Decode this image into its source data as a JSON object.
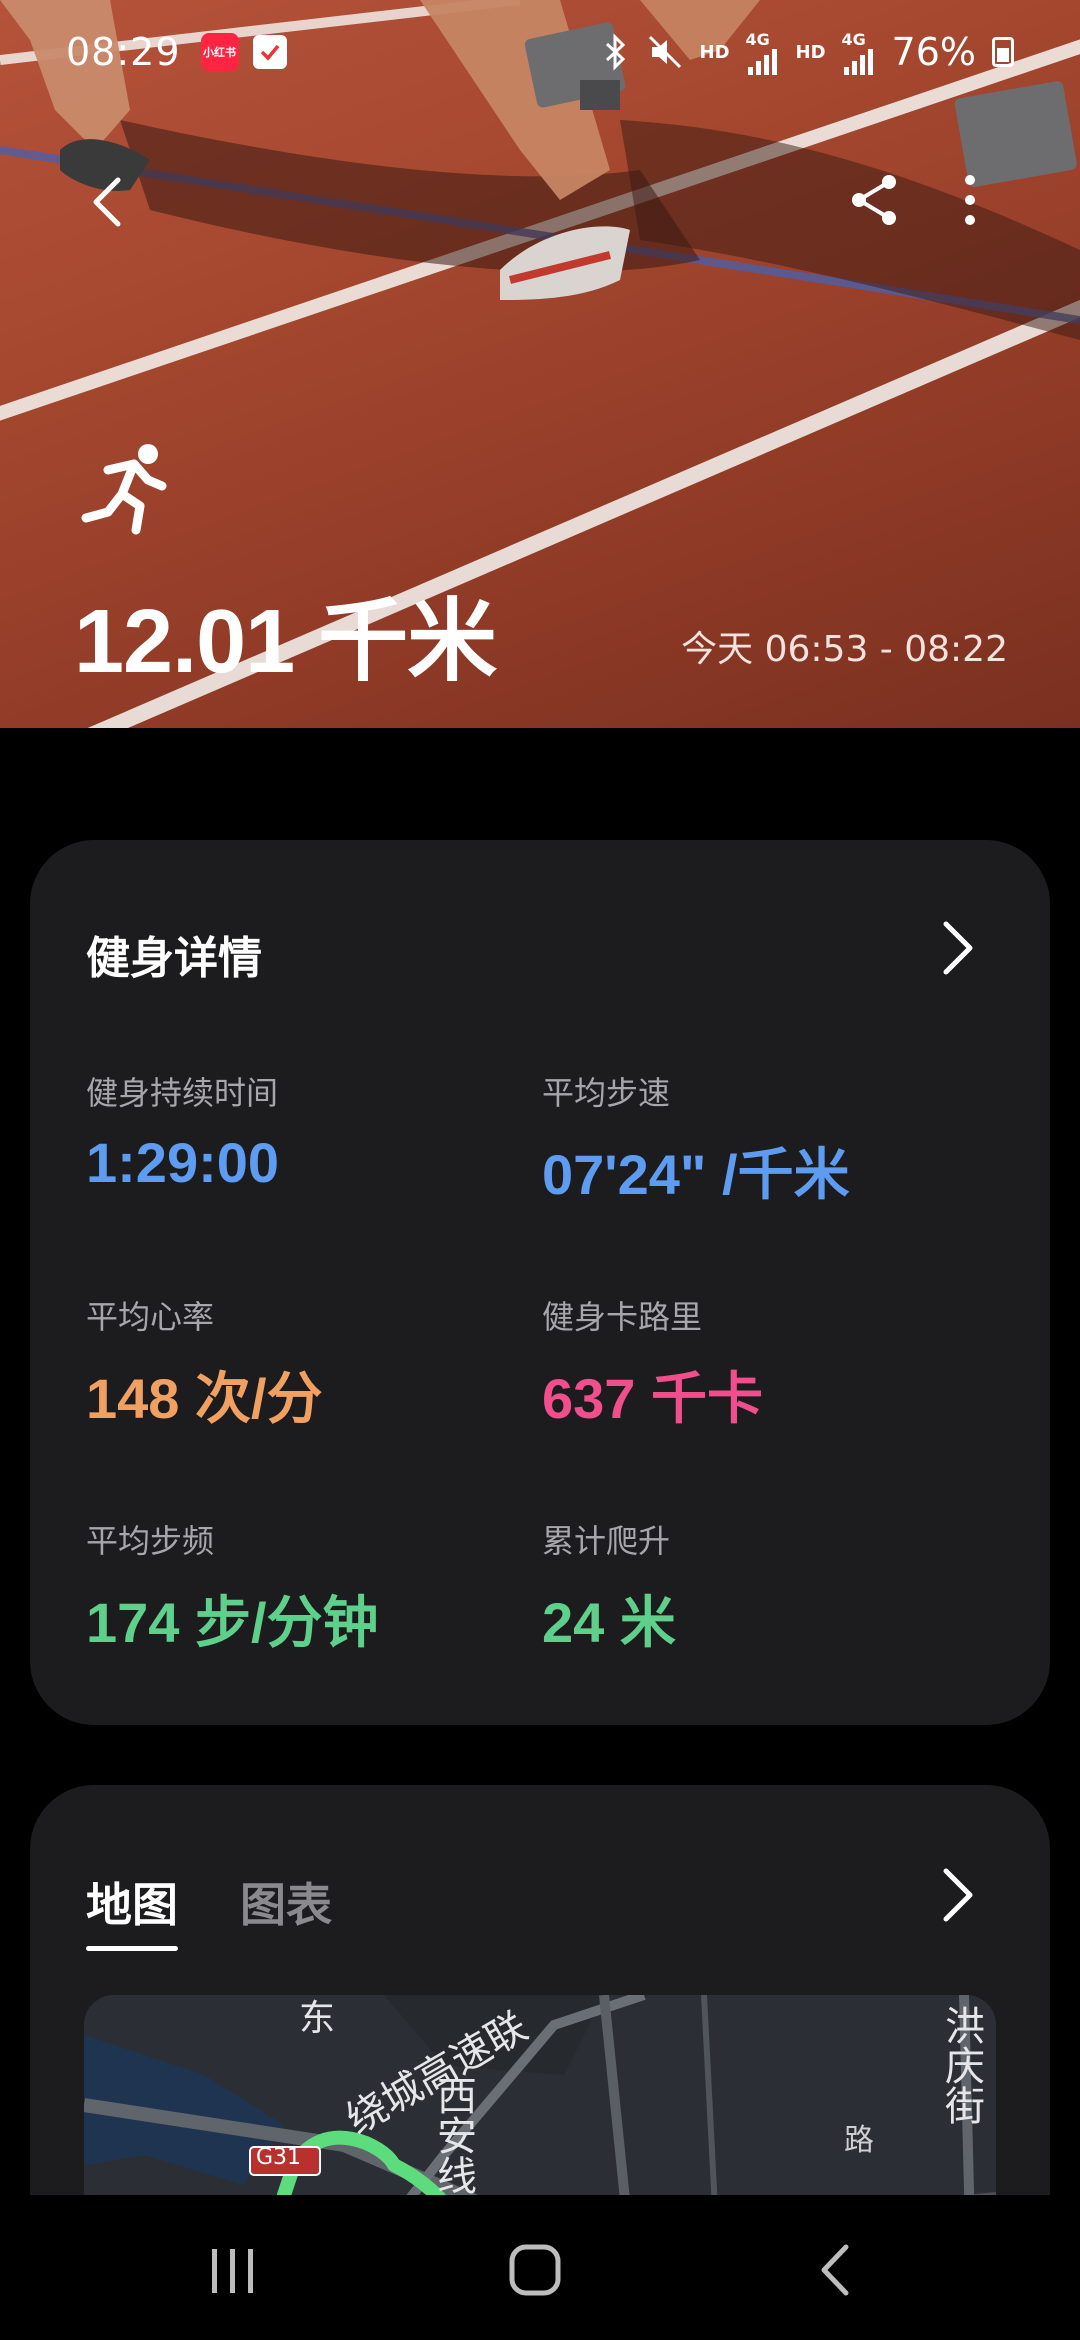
{
  "status_bar": {
    "time": "08:29",
    "app_badge": "小红书",
    "hd1": "HD",
    "net1": "4G",
    "hd2": "HD",
    "net2": "4G",
    "battery": "76%"
  },
  "hero": {
    "distance": "12.01 千米",
    "time_range": "今天 06:53 - 08:22"
  },
  "details": {
    "title": "健身详情",
    "metrics": [
      {
        "label": "健身持续时间",
        "value": "1:29:00",
        "color": "#5e9cf2"
      },
      {
        "label": "平均步速",
        "value": "07'24\" /千米",
        "color": "#5e9cf2"
      },
      {
        "label": "平均心率",
        "value": "148 次/分",
        "color": "#f0a060"
      },
      {
        "label": "健身卡路里",
        "value": "637 千卡",
        "color": "#f04e8c"
      },
      {
        "label": "平均步频",
        "value": "174 步/分钟",
        "color": "#5fd08c"
      },
      {
        "label": "累计爬升",
        "value": "24 米",
        "color": "#5fd08c"
      }
    ]
  },
  "map_card": {
    "tabs": [
      {
        "label": "地图",
        "active": true
      },
      {
        "label": "图表",
        "active": false
      }
    ],
    "map_labels": {
      "road_expressway": "绕城高速联",
      "road_xian": "西安线",
      "street": "洪庆街",
      "road_code": "G31",
      "road_bottom": "路",
      "top_fragment": "东"
    }
  },
  "icons": {
    "back": "chevron-left-icon",
    "share": "share-icon",
    "more": "more-vertical-icon",
    "run": "running-person-icon"
  }
}
